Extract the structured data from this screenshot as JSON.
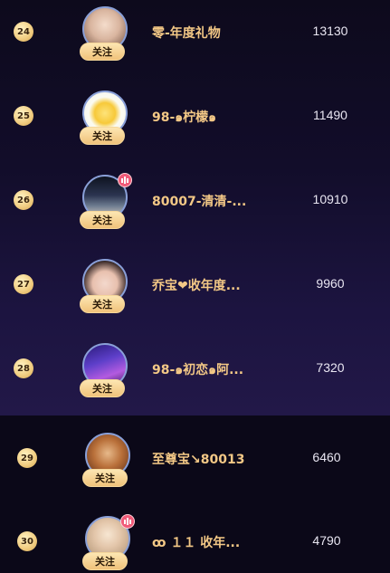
{
  "follow_label": "关注",
  "rows": [
    {
      "rank": "24",
      "name": "零-年度礼物",
      "score": "13130",
      "live": false
    },
    {
      "rank": "25",
      "name": "98-๑柠檬๑",
      "score": "11490",
      "live": false
    },
    {
      "rank": "26",
      "name": "80007-清清-...",
      "score": "10910",
      "live": true
    },
    {
      "rank": "27",
      "name": "乔宝❤收年度...",
      "score": "9960",
      "live": false
    },
    {
      "rank": "28",
      "name": "98-๑初恋๑阿...",
      "score": "7320",
      "live": false
    },
    {
      "rank": "29",
      "name": "至尊宝↘80013",
      "score": "6460",
      "live": false
    },
    {
      "rank": "30",
      "name": "ꝏ １１ 收年...",
      "score": "4790",
      "live": true
    }
  ],
  "colors": {
    "name": "#f3c886",
    "score": "#e9e6f2",
    "follow_button": "#f0c27a",
    "rank_badge": "#f2cf84",
    "live_badge": "#f05a78",
    "background_top": "#0d0a1c",
    "background_bottom": "#221848"
  },
  "icons": {
    "live": "live-bars-icon"
  }
}
